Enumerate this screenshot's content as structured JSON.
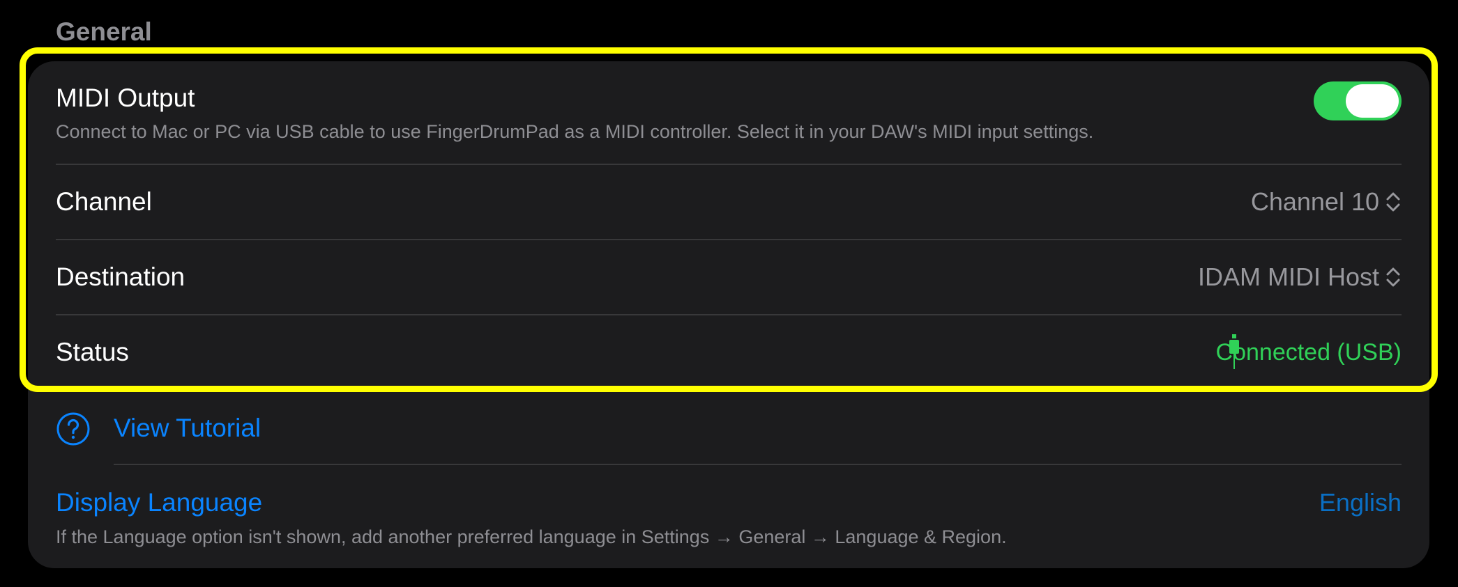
{
  "section": {
    "title": "General"
  },
  "midi_output": {
    "label": "MIDI Output",
    "description": "Connect to Mac or PC via USB cable to use FingerDrumPad as a MIDI controller. Select it in your DAW's MIDI input settings.",
    "toggle_on": true,
    "toggle_color": "#30d158"
  },
  "channel": {
    "label": "Channel",
    "value": "Channel 10",
    "icon": "chevron-up-down-icon"
  },
  "destination": {
    "label": "Destination",
    "value": "IDAM MIDI Host",
    "icon": "chevron-up-down-icon"
  },
  "status": {
    "label": "Status",
    "value": "Connected (USB)",
    "icon": "usb-cable-icon",
    "color": "#30d158"
  },
  "tutorial": {
    "label": "View Tutorial",
    "icon": "question-circle-icon"
  },
  "display_language": {
    "label": "Display Language",
    "value": "English",
    "description": "If the Language option isn't shown, add another preferred language in Settings → General → Language & Region."
  },
  "colors": {
    "background": "#000000",
    "card": "#1c1c1e",
    "accent": "#0a84ff",
    "highlight": "#ffff00"
  }
}
